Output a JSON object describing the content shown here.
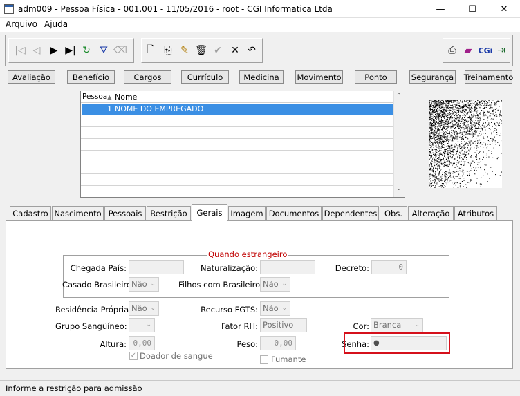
{
  "window": {
    "title": "adm009 - Pessoa Física - 001.001 - 11/05/2016 - root - CGI Informatica Ltda",
    "minimize": "—",
    "maximize": "☐",
    "close": "✕"
  },
  "menu": [
    {
      "label": "Arquivo"
    },
    {
      "label": "Ajuda"
    }
  ],
  "toolbar": {
    "nav": [
      {
        "icon": "first-record-icon",
        "glyph": "|◁"
      },
      {
        "icon": "previous-record-icon",
        "glyph": "◁"
      },
      {
        "icon": "next-record-icon",
        "glyph": "▶"
      },
      {
        "icon": "last-record-icon",
        "glyph": "▶|"
      },
      {
        "icon": "refresh-icon",
        "glyph": "↻"
      },
      {
        "icon": "filter-icon",
        "glyph": "⛛"
      },
      {
        "icon": "eraser-icon",
        "glyph": "⌫"
      }
    ],
    "edit": [
      {
        "icon": "new-icon",
        "glyph": "🗋"
      },
      {
        "icon": "copy-icon",
        "glyph": "⎘"
      },
      {
        "icon": "edit-icon",
        "glyph": "✎"
      },
      {
        "icon": "delete-icon",
        "glyph": "🗑"
      },
      {
        "icon": "confirm-icon",
        "glyph": "✔"
      },
      {
        "icon": "cancel-icon",
        "glyph": "✕"
      },
      {
        "icon": "undo-icon",
        "glyph": "↶"
      }
    ],
    "right": [
      {
        "icon": "print-icon",
        "glyph": "⎙"
      },
      {
        "icon": "book-icon",
        "glyph": "▰"
      },
      {
        "icon": "cgi-icon",
        "glyph": "CGi"
      },
      {
        "icon": "exit-icon",
        "glyph": "⇥"
      }
    ]
  },
  "modules": [
    "Avaliação",
    "Benefício",
    "Cargos",
    "Currículo",
    "Medicina",
    "Movimento",
    "Ponto",
    "Segurança",
    "Treinamento"
  ],
  "grid": {
    "columns": [
      "Pessoa",
      "Nome"
    ],
    "rows": [
      {
        "id": "1",
        "name": "NOME DO EMPREGADO"
      }
    ]
  },
  "tabs": [
    "Cadastro",
    "Nascimento",
    "Pessoais",
    "Restrição",
    "Gerais",
    "Imagem",
    "Documentos",
    "Dependentes",
    "Obs.",
    "Alteração",
    "Atributos"
  ],
  "active_tab": "Gerais",
  "estrangeiro": {
    "legend": "Quando estrangeiro",
    "chegada_label": "Chegada País:",
    "chegada_value": "",
    "naturalizacao_label": "Naturalização:",
    "naturalizacao_value": "",
    "decreto_label": "Decreto:",
    "decreto_value": "0",
    "casado_label": "Casado Brasileiro:",
    "casado_value": "Não",
    "filhos_label": "Filhos com Brasileiro:",
    "filhos_value": "Não"
  },
  "gerais": {
    "residencia_label": "Residência Própria:",
    "residencia_value": "Não",
    "fgts_label": "Recurso FGTS:",
    "fgts_value": "Não",
    "grupo_label": "Grupo Sangüíneo:",
    "grupo_value": "",
    "fator_label": "Fator RH:",
    "fator_value": "Positivo",
    "cor_label": "Cor:",
    "cor_value": "Branca",
    "altura_label": "Altura:",
    "altura_value": "0,00",
    "peso_label": "Peso:",
    "peso_value": "0,00",
    "senha_label": "Senha:",
    "senha_value": "●",
    "doador_label": "Doador de sangue",
    "doador_checked": true,
    "fumante_label": "Fumante",
    "fumante_checked": false
  },
  "status": "Informe a restrição para admissão",
  "colors": {
    "highlight": "#d5101b",
    "selection": "#3b8fe4",
    "legend": "#c00000"
  }
}
